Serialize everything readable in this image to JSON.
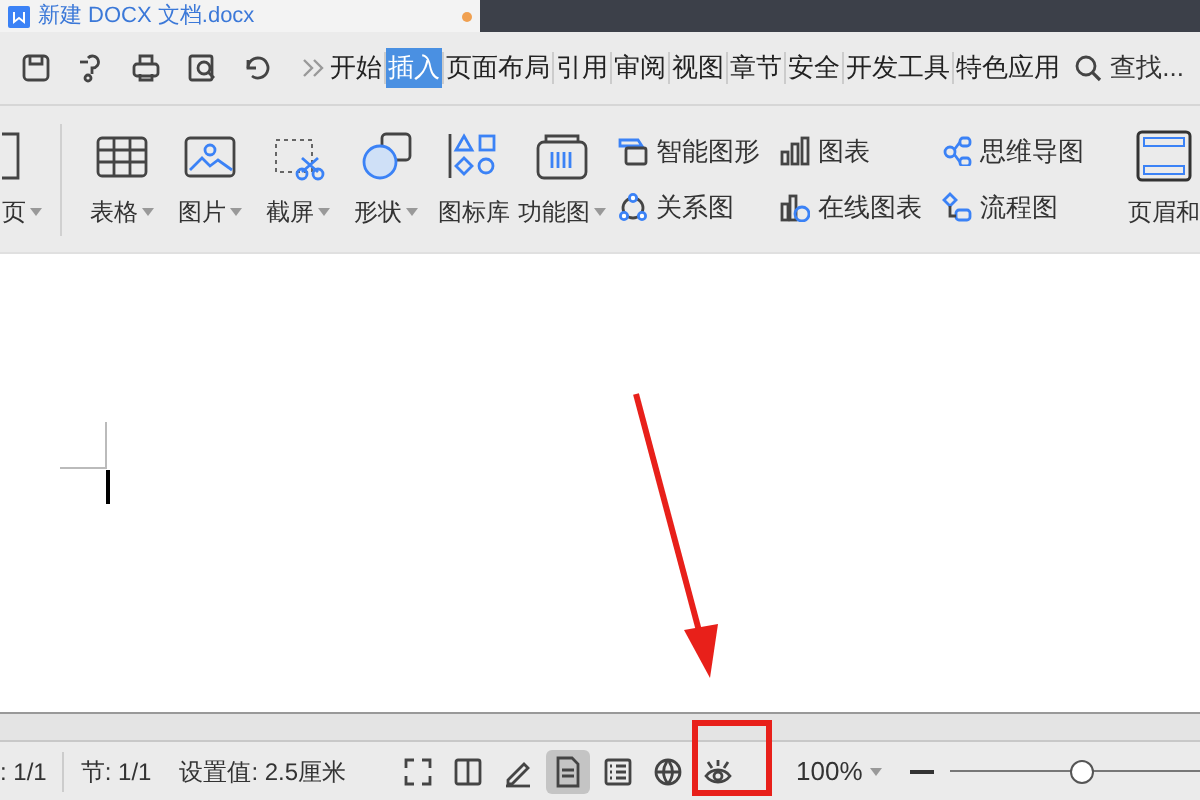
{
  "document_tab": {
    "title": "新建 DOCX 文档.docx"
  },
  "quick_tools": [
    {
      "kind": "save"
    },
    {
      "kind": "format"
    },
    {
      "kind": "print"
    },
    {
      "kind": "preview"
    },
    {
      "kind": "undo"
    },
    {
      "kind": "more"
    }
  ],
  "menu_tabs": [
    {
      "label": "开始",
      "selected": false
    },
    {
      "label": "插入",
      "selected": true
    },
    {
      "label": "页面布局",
      "selected": false
    },
    {
      "label": "引用",
      "selected": false
    },
    {
      "label": "审阅",
      "selected": false
    },
    {
      "label": "视图",
      "selected": false
    },
    {
      "label": "章节",
      "selected": false
    },
    {
      "label": "安全",
      "selected": false
    },
    {
      "label": "开发工具",
      "selected": false
    },
    {
      "label": "特色应用",
      "selected": false
    }
  ],
  "search": {
    "label": "查找..."
  },
  "ribbon_large": [
    {
      "kind": "page",
      "label": "页",
      "dropdown": true
    },
    {
      "kind": "table",
      "label": "表格",
      "dropdown": true
    },
    {
      "kind": "picture",
      "label": "图片",
      "dropdown": true
    },
    {
      "kind": "screenshot",
      "label": "截屏",
      "dropdown": true
    },
    {
      "kind": "shape",
      "label": "形状",
      "dropdown": true
    },
    {
      "kind": "iconlib",
      "label": "图标库",
      "dropdown": false
    },
    {
      "kind": "function",
      "label": "功能图",
      "dropdown": true
    }
  ],
  "ribbon_small": [
    {
      "kind": "smartart",
      "label": "智能图形"
    },
    {
      "kind": "relation",
      "label": "关系图"
    },
    {
      "kind": "chart",
      "label": "图表"
    },
    {
      "kind": "onlinechart",
      "label": "在线图表"
    },
    {
      "kind": "mindmap",
      "label": "思维导图"
    },
    {
      "kind": "flow",
      "label": "流程图"
    }
  ],
  "ribbon_end": {
    "label": "页眉和"
  },
  "status": {
    "texts": [
      ": 1/1",
      "节: 1/1",
      "设置值: 2.5厘米"
    ],
    "view_buttons": [
      {
        "kind": "fullscreen",
        "selected": false
      },
      {
        "kind": "reading",
        "selected": false
      },
      {
        "kind": "edit",
        "selected": false
      },
      {
        "kind": "page",
        "selected": true
      },
      {
        "kind": "outline",
        "selected": false
      },
      {
        "kind": "web",
        "selected": false
      },
      {
        "kind": "eye",
        "selected": false
      }
    ],
    "zoom": "100%",
    "zoom_slider": {
      "level": 0.53
    }
  }
}
